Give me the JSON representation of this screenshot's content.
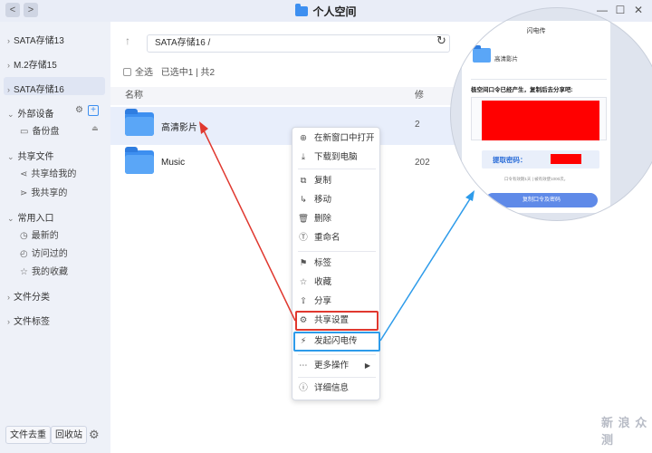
{
  "window": {
    "title": "个人空间",
    "back": "<",
    "forward": ">",
    "minimize": "—",
    "maximize": "☐",
    "close": "✕"
  },
  "sidebar": {
    "drives": [
      {
        "label": "SATA存储13"
      },
      {
        "label": "M.2存储15"
      },
      {
        "label": "SATA存储16",
        "active": true
      }
    ],
    "external": {
      "header": "外部设备",
      "items": [
        {
          "label": "备份盘"
        }
      ]
    },
    "shared": {
      "header": "共享文件",
      "items": [
        {
          "label": "共享给我的"
        },
        {
          "label": "我共享的"
        }
      ]
    },
    "quick": {
      "header": "常用入口",
      "items": [
        {
          "label": "最新的"
        },
        {
          "label": "访问过的"
        },
        {
          "label": "我的收藏"
        }
      ]
    },
    "categories": {
      "header": "文件分类"
    },
    "tags": {
      "header": "文件标签"
    },
    "bottom": {
      "dedupe": "文件去重",
      "recycle": "回收站"
    }
  },
  "toolbar": {
    "path": "SATA存储16 /"
  },
  "selection": {
    "select_all": "全选",
    "status": "已选中1 | 共2"
  },
  "table": {
    "headers": {
      "name": "名称",
      "modified": "修"
    },
    "rows": [
      {
        "name": "高清影片",
        "date": "2",
        "selected": true
      },
      {
        "name": "Music",
        "date": "202"
      }
    ]
  },
  "context_menu": {
    "items": [
      {
        "label": "在新窗口中打开",
        "icon": "open-new-window-icon"
      },
      {
        "label": "下载到电脑",
        "icon": "download-icon"
      },
      {
        "label": "复制",
        "icon": "copy-icon"
      },
      {
        "label": "移动",
        "icon": "move-icon"
      },
      {
        "label": "删除",
        "icon": "delete-icon"
      },
      {
        "label": "重命名",
        "icon": "rename-icon"
      },
      {
        "label": "标签",
        "icon": "tag-icon"
      },
      {
        "label": "收藏",
        "icon": "star-icon"
      },
      {
        "label": "分享",
        "icon": "share-icon"
      },
      {
        "label": "共享设置",
        "icon": "share-settings-icon"
      },
      {
        "label": "发起闪电传",
        "icon": "flash-transfer-icon"
      },
      {
        "label": "更多操作",
        "icon": "more-icon"
      },
      {
        "label": "详细信息",
        "icon": "info-icon"
      }
    ]
  },
  "zoom_dialog": {
    "title": "闪电传",
    "folder_name": "高清影片",
    "note": "极空间口令已经产生，复制后去分享吧:",
    "code_label": "提取密码：",
    "hint": "口令有效期1天 | 被有效使1000次。",
    "button": "复制口令及密码"
  },
  "watermark": "新 浪 众测",
  "colors": {
    "accent": "#3d8ff0",
    "highlight_red": "#e0382f",
    "highlight_blue": "#2d9bea",
    "redaction": "#ff0000"
  }
}
